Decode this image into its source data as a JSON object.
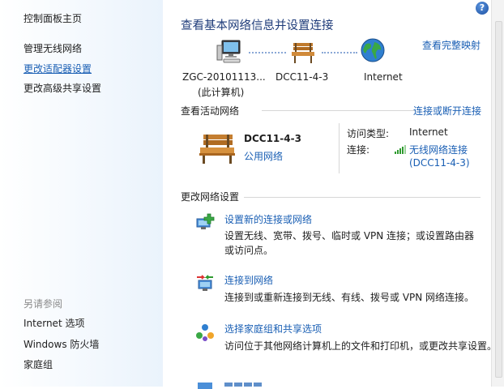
{
  "sidebar": {
    "items": [
      {
        "label": "控制面板主页"
      },
      {
        "label": "管理无线网络"
      },
      {
        "label": "更改适配器设置"
      },
      {
        "label": "更改高级共享设置"
      }
    ],
    "see_also_header": "另请参阅",
    "see_also": [
      {
        "label": "Internet 选项"
      },
      {
        "label": "Windows 防火墙"
      },
      {
        "label": "家庭组"
      }
    ]
  },
  "main": {
    "title": "查看基本网络信息并设置连接",
    "full_map_link": "查看完整映射",
    "map": {
      "computer_name": "ZGC-20101113...",
      "computer_sub": "(此计算机)",
      "network_name": "DCC11-4-3",
      "internet_label": "Internet"
    },
    "active": {
      "header": "查看活动网络",
      "connect_link": "连接或断开连接",
      "network_name": "DCC11-4-3",
      "network_type": "公用网络",
      "access_type_label": "访问类型:",
      "access_type_value": "Internet",
      "connection_label": "连接:",
      "connection_value": "无线网络连接",
      "connection_sub": "(DCC11-4-3)"
    },
    "change": {
      "header": "更改网络设置",
      "tasks": [
        {
          "link": "设置新的连接或网络",
          "desc1": "设置无线、宽带、拨号、临时或 VPN 连接；或设置路由器",
          "desc2": "或访问点。"
        },
        {
          "link": "连接到网络",
          "desc1": "连接到或重新连接到无线、有线、拨号或 VPN 网络连接。",
          "desc2": ""
        },
        {
          "link": "选择家庭组和共享选项",
          "desc1": "访问位于其他网络计算机上的文件和打印机，或更改共享设置。",
          "desc2": ""
        }
      ]
    }
  },
  "colors": {
    "link": "#1a5fb4",
    "title": "#1f3c7a"
  }
}
